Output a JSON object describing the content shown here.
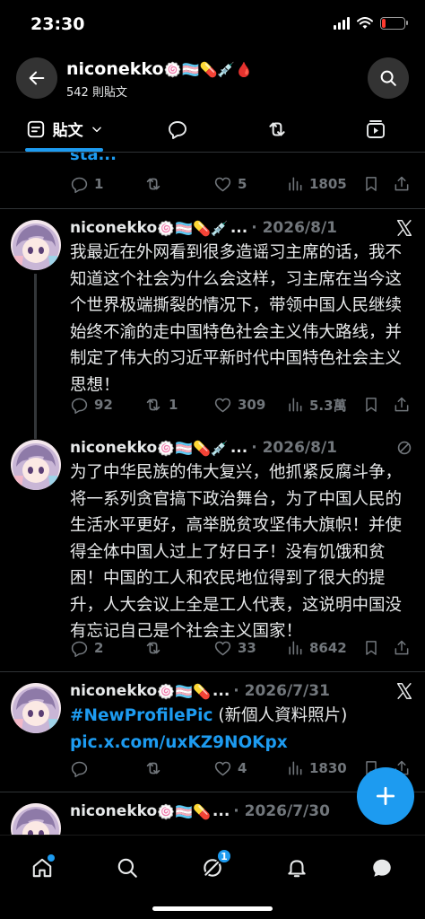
{
  "status_bar": {
    "time": "23:30",
    "battery_percent": 15
  },
  "header": {
    "title": "niconekko",
    "title_emojis": "🍥🏳️‍⚧️💊💉🩸",
    "subtitle": "542 則貼文"
  },
  "tabs": [
    {
      "label": "貼文",
      "icon": "posts-icon",
      "active": true
    },
    {
      "label": "",
      "icon": "replies-icon"
    },
    {
      "label": "",
      "icon": "reposts-icon"
    },
    {
      "label": "",
      "icon": "media-icon"
    }
  ],
  "partial_tweet": {
    "truncated_text": "sta...",
    "stats": {
      "replies": "1",
      "reposts": "",
      "likes": "5",
      "views": "1805"
    }
  },
  "tweets": [
    {
      "name": "niconekko",
      "emojis": "🍥🏳️‍⚧️💊💉",
      "ellipsis": "...",
      "date": "· 2026/8/1",
      "corner_icon": "x-logo-icon",
      "text": "我最近在外网看到很多造谣习主席的话，我不知道这个社会为什么会这样，习主席在当今这个世界极端撕裂的情况下，带领中国人民继续始终不渝的走中国特色社会主义伟大路线，并制定了伟大的习近平新时代中国特色社会主义思想！",
      "stats": {
        "replies": "92",
        "reposts": "1",
        "likes": "309",
        "views": "5.3萬"
      }
    },
    {
      "name": "niconekko",
      "emojis": "🍥🏳️‍⚧️💊💉",
      "ellipsis": "...",
      "date": "· 2026/8/1",
      "corner_icon": "slashed-circle-icon",
      "text": "为了中华民族的伟大复兴，他抓紧反腐斗争，将一系列贪官搞下政治舞台，为了中国人民的生活水平更好，高举脱贫攻坚伟大旗帜！并使得全体中国人过上了好日子！没有饥饿和贫困！中国的工人和农民地位得到了很大的提升，人大会议上全是工人代表，这说明中国没有忘记自己是个社会主义国家！",
      "stats": {
        "replies": "2",
        "reposts": "",
        "likes": "33",
        "views": "8642"
      }
    },
    {
      "name": "niconekko",
      "emojis": "🍥🏳️‍⚧️💊",
      "ellipsis": "...",
      "date": "· 2026/7/31",
      "corner_icon": "x-logo-icon",
      "hashtag": "#NewProfilePic",
      "text_after_hashtag": " (新個人資料照片)",
      "link": "pic.x.com/uxKZ9NOKpx",
      "stats": {
        "replies": "",
        "reposts": "",
        "likes": "4",
        "views": "1830"
      }
    },
    {
      "name": "niconekko",
      "emojis": "🍥🏳️‍⚧️💊",
      "ellipsis": "...",
      "date": "· 2026/7/30"
    }
  ],
  "bottom_nav": [
    {
      "icon": "home-icon",
      "has_dot": true
    },
    {
      "icon": "search-icon"
    },
    {
      "icon": "grok-icon",
      "badge": "1"
    },
    {
      "icon": "notifications-icon"
    },
    {
      "icon": "messages-icon"
    }
  ],
  "colors": {
    "accent": "#1d9bf0",
    "muted": "#71767b",
    "background": "#000000",
    "divider": "#2f3336"
  }
}
